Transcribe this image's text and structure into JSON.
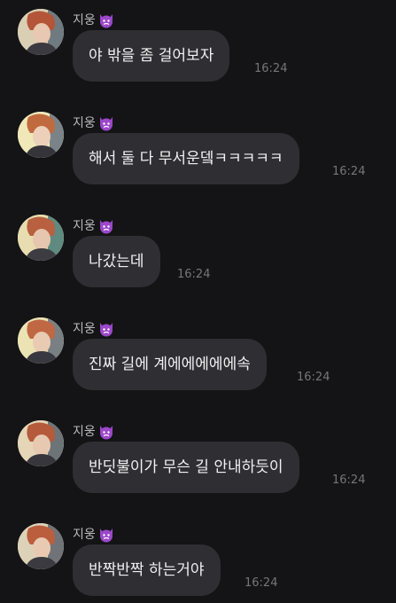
{
  "sender": {
    "name": "지웅",
    "emoji": "angry-devil-emoji"
  },
  "messages": [
    {
      "text": "야 밖을 좀 걸어보자",
      "time": "16:24"
    },
    {
      "text": "해서 둘 다 무서운뎈ㅋㅋㅋㅋㅋ",
      "time": "16:24"
    },
    {
      "text": "나갔는데",
      "time": "16:24"
    },
    {
      "text": "진짜 길에 계에에에에에속",
      "time": "16:24"
    },
    {
      "text": "반딧불이가 무슨 길 안내하듯이",
      "time": "16:24"
    },
    {
      "text": "반짝반짝 하는거야",
      "time": "16:24"
    }
  ],
  "colors": {
    "background": "#141416",
    "bubble": "#2e2e33",
    "bubble_text": "#f1f1f3",
    "sender_text": "#b9b9bd",
    "time_text": "#75757b",
    "emoji": "#9b48c9"
  }
}
